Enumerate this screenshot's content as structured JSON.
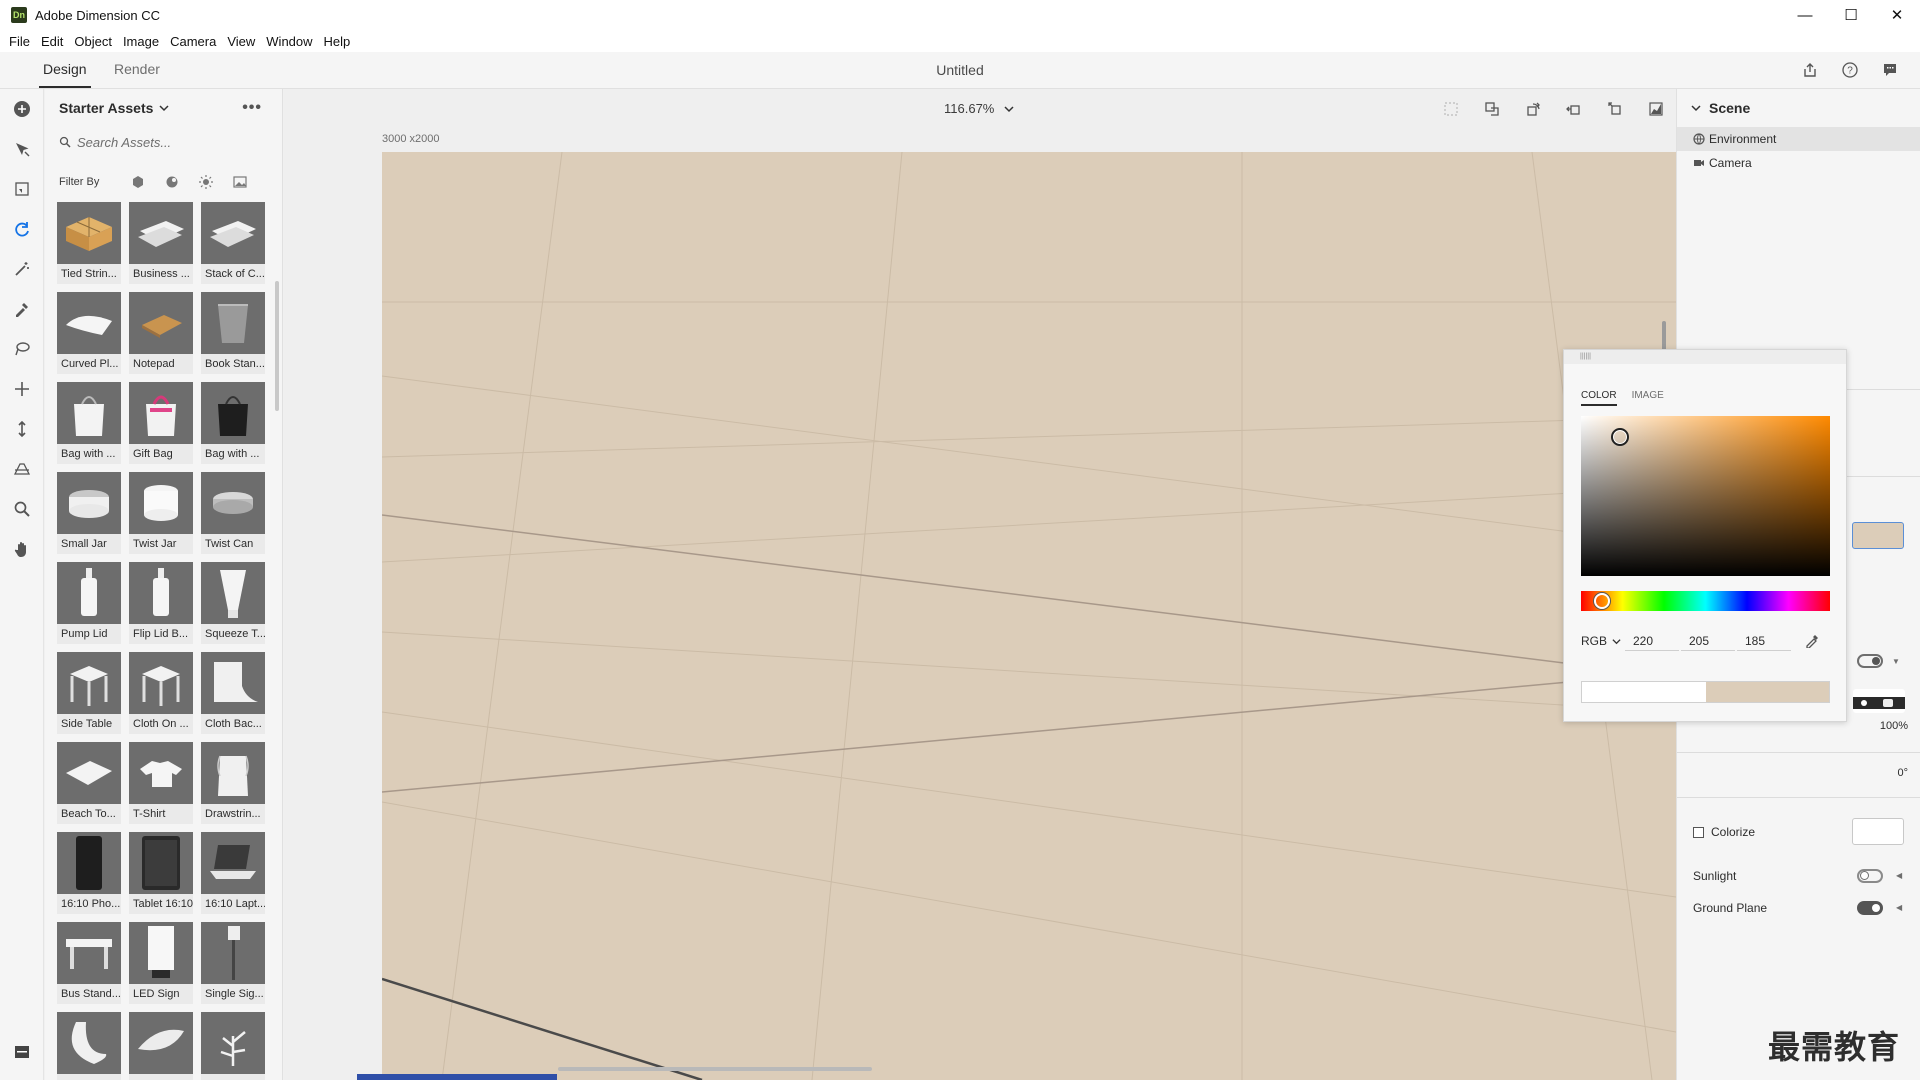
{
  "window": {
    "app_icon_text": "Dn",
    "title": "Adobe Dimension CC",
    "minimize": "—",
    "maximize": "☐",
    "close": "✕"
  },
  "menu": [
    "File",
    "Edit",
    "Object",
    "Image",
    "Camera",
    "View",
    "Window",
    "Help"
  ],
  "tabs": {
    "design": "Design",
    "render": "Render",
    "active": "Design"
  },
  "document": {
    "title": "Untitled"
  },
  "header_icons": [
    "share-icon",
    "help-icon",
    "comment-icon"
  ],
  "toolbar": [
    "add-icon",
    "select-icon",
    "select-bounds-icon",
    "orbit-icon",
    "magic-wand-icon",
    "sample-material-icon",
    "magic-lasso-icon",
    "pan-icon",
    "dolly-icon",
    "horizon-icon",
    "zoom-icon",
    "hand-icon",
    "panel-toggle-icon"
  ],
  "assets": {
    "header": "Starter Assets",
    "search_placeholder": "Search Assets...",
    "filter_label": "Filter By",
    "filter_icons": [
      "model-filter-icon",
      "material-filter-icon",
      "light-filter-icon",
      "image-filter-icon"
    ],
    "items": [
      {
        "label": "Tied Strin...",
        "kind": "box"
      },
      {
        "label": "Business ...",
        "kind": "cards"
      },
      {
        "label": "Stack of C...",
        "kind": "cards"
      },
      {
        "label": "Curved Pl...",
        "kind": "paper"
      },
      {
        "label": "Notepad",
        "kind": "notepad"
      },
      {
        "label": "Book Stan...",
        "kind": "book"
      },
      {
        "label": "Bag with ...",
        "kind": "bag"
      },
      {
        "label": "Gift Bag",
        "kind": "giftbag"
      },
      {
        "label": "Bag with ...",
        "kind": "darkbag"
      },
      {
        "label": "Small Jar",
        "kind": "jar"
      },
      {
        "label": "Twist Jar",
        "kind": "twistjar"
      },
      {
        "label": "Twist Can",
        "kind": "can"
      },
      {
        "label": "Pump Lid",
        "kind": "bottle"
      },
      {
        "label": "Flip Lid B...",
        "kind": "bottle"
      },
      {
        "label": "Squeeze T...",
        "kind": "tube"
      },
      {
        "label": "Side Table",
        "kind": "table"
      },
      {
        "label": "Cloth On ...",
        "kind": "table"
      },
      {
        "label": "Cloth Bac...",
        "kind": "backdrop"
      },
      {
        "label": "Beach To...",
        "kind": "towel"
      },
      {
        "label": "T-Shirt",
        "kind": "shirt"
      },
      {
        "label": "Drawstrin...",
        "kind": "drawstring"
      },
      {
        "label": "16:10 Pho...",
        "kind": "phone"
      },
      {
        "label": "Tablet 16:10",
        "kind": "tablet"
      },
      {
        "label": "16:10 Lapt...",
        "kind": "laptop"
      },
      {
        "label": "Bus Stand...",
        "kind": "bench"
      },
      {
        "label": "LED Sign",
        "kind": "ledsign"
      },
      {
        "label": "Single Sig...",
        "kind": "sign"
      },
      {
        "label": "",
        "kind": "ring"
      },
      {
        "label": "",
        "kind": "leaf"
      },
      {
        "label": "",
        "kind": "plant"
      }
    ]
  },
  "canvas": {
    "zoom": "116.67%",
    "dimensions": "3000 x2000",
    "background_color": "#dccdb9",
    "view_icons": [
      "frame-icon",
      "fit-icon",
      "orbit-view-icon",
      "pan-view-icon",
      "dolly-view-icon",
      "histogram-icon"
    ]
  },
  "scene": {
    "header": "Scene",
    "items": [
      {
        "label": "Environment",
        "icon": "environment-icon",
        "selected": true
      },
      {
        "label": "Camera",
        "icon": "camera-icon",
        "selected": false
      }
    ],
    "intensity": "100%",
    "rotation": "0°",
    "colorize_label": "Colorize",
    "sunlight_label": "Sunlight",
    "sunlight_on": false,
    "ground_plane_label": "Ground Plane",
    "ground_plane_on": true
  },
  "color_picker": {
    "grip": "||||||",
    "tab_color": "COLOR",
    "tab_image": "IMAGE",
    "mode": "RGB",
    "r": "220",
    "g": "205",
    "b": "185",
    "selected_hex": "#dccdb9",
    "hue_hex": "#ff8a00"
  },
  "watermark": "最需教育"
}
